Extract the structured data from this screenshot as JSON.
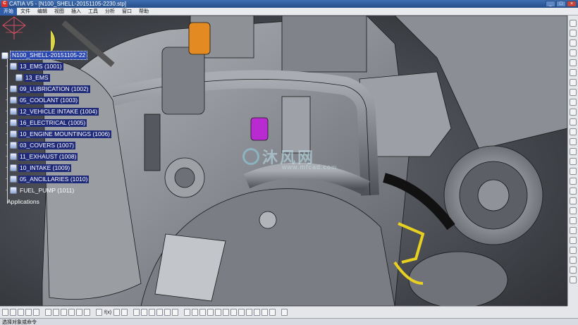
{
  "window": {
    "title": "CATIA V5 - [N100_SHELL-20151105-2230.stp]",
    "app_icon": "catia-icon",
    "buttons": [
      "_",
      "□",
      "×"
    ]
  },
  "menubar": {
    "items": [
      {
        "label": "开始",
        "active": true
      },
      {
        "label": "文件",
        "active": false
      },
      {
        "label": "编辑",
        "active": false
      },
      {
        "label": "视图",
        "active": false
      },
      {
        "label": "插入",
        "active": false
      },
      {
        "label": "工具",
        "active": false
      },
      {
        "label": "分析",
        "active": false
      },
      {
        "label": "窗口",
        "active": false
      },
      {
        "label": "帮助",
        "active": false
      }
    ]
  },
  "tree": {
    "root": "N100_SHELL-20151105-22",
    "nodes": [
      {
        "label": "13_EMS (1001)"
      },
      {
        "label": "13_EMS"
      },
      {
        "label": "09_LUBRICATION (1002)"
      },
      {
        "label": "05_COOLANT (1003)"
      },
      {
        "label": "12_VEHICLE INTAKE (1004)"
      },
      {
        "label": "16_ELECTRICAL (1005)"
      },
      {
        "label": "10_ENGINE MOUNTINGS (1006)"
      },
      {
        "label": "03_COVERS (1007)"
      },
      {
        "label": "11_EXHAUST (1008)"
      },
      {
        "label": "10_INTAKE (1009)"
      },
      {
        "label": "05_ANCILLARIES (1010)"
      },
      {
        "label": "FUEL_PUMP (1011)"
      }
    ],
    "applications": "Applications"
  },
  "watermark": {
    "text": "沐风网",
    "url": "www.mfcad.com"
  },
  "bottom_toolbar": {
    "command_label": "f(x)"
  },
  "status": {
    "message": "选择对象或命令"
  },
  "colors": {
    "tree_highlight": "#1f2a78",
    "engine_metal": "#8d9096",
    "accent_orange": "#e38a22",
    "accent_magenta": "#b92ad0",
    "accent_yellow": "#e7d020"
  }
}
